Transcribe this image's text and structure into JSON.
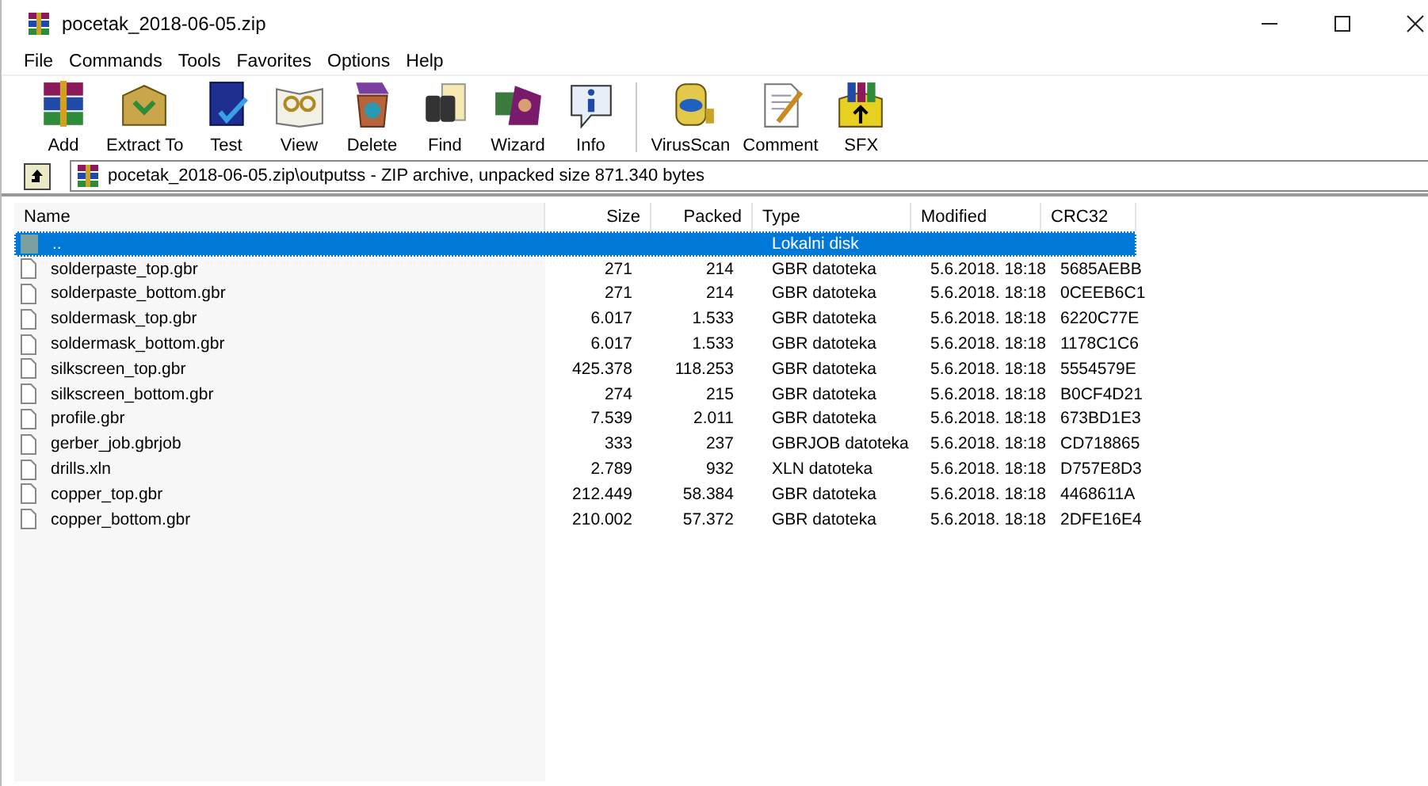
{
  "window": {
    "title": "pocetak_2018-06-05.zip"
  },
  "menu": [
    "File",
    "Commands",
    "Tools",
    "Favorites",
    "Options",
    "Help"
  ],
  "toolbar": [
    {
      "label": "Add",
      "kind": "add"
    },
    {
      "label": "Extract To",
      "kind": "extract"
    },
    {
      "label": "Test",
      "kind": "test"
    },
    {
      "label": "View",
      "kind": "view"
    },
    {
      "label": "Delete",
      "kind": "delete"
    },
    {
      "label": "Find",
      "kind": "find"
    },
    {
      "label": "Wizard",
      "kind": "wizard"
    },
    {
      "label": "Info",
      "kind": "info"
    },
    {
      "label": "VirusScan",
      "kind": "virus",
      "separator_before": true
    },
    {
      "label": "Comment",
      "kind": "comment"
    },
    {
      "label": "SFX",
      "kind": "sfx"
    }
  ],
  "address": {
    "path": "pocetak_2018-06-05.zip\\outputss - ZIP archive, unpacked size 871.340 bytes"
  },
  "table": {
    "columns": [
      "Name",
      "Size",
      "Packed",
      "Type",
      "Modified",
      "CRC32"
    ],
    "rows": [
      {
        "kind": "up",
        "name": "..",
        "size": "",
        "packed": "",
        "type": "Lokalni disk",
        "modified": "",
        "crc": "",
        "selected": true
      },
      {
        "kind": "file",
        "name": "solderpaste_top.gbr",
        "size": "271",
        "packed": "214",
        "type": "GBR datoteka",
        "modified": "5.6.2018. 18:18",
        "crc": "5685AEBB",
        "selected": false
      },
      {
        "kind": "file",
        "name": "solderpaste_bottom.gbr",
        "size": "271",
        "packed": "214",
        "type": "GBR datoteka",
        "modified": "5.6.2018. 18:18",
        "crc": "0CEEB6C1",
        "selected": false
      },
      {
        "kind": "file",
        "name": "soldermask_top.gbr",
        "size": "6.017",
        "packed": "1.533",
        "type": "GBR datoteka",
        "modified": "5.6.2018. 18:18",
        "crc": "6220C77E",
        "selected": false
      },
      {
        "kind": "file",
        "name": "soldermask_bottom.gbr",
        "size": "6.017",
        "packed": "1.533",
        "type": "GBR datoteka",
        "modified": "5.6.2018. 18:18",
        "crc": "1178C1C6",
        "selected": false
      },
      {
        "kind": "file",
        "name": "silkscreen_top.gbr",
        "size": "425.378",
        "packed": "118.253",
        "type": "GBR datoteka",
        "modified": "5.6.2018. 18:18",
        "crc": "5554579E",
        "selected": false
      },
      {
        "kind": "file",
        "name": "silkscreen_bottom.gbr",
        "size": "274",
        "packed": "215",
        "type": "GBR datoteka",
        "modified": "5.6.2018. 18:18",
        "crc": "B0CF4D21",
        "selected": false
      },
      {
        "kind": "file",
        "name": "profile.gbr",
        "size": "7.539",
        "packed": "2.011",
        "type": "GBR datoteka",
        "modified": "5.6.2018. 18:18",
        "crc": "673BD1E3",
        "selected": false
      },
      {
        "kind": "file",
        "name": "gerber_job.gbrjob",
        "size": "333",
        "packed": "237",
        "type": "GBRJOB datoteka",
        "modified": "5.6.2018. 18:18",
        "crc": "CD718865",
        "selected": false
      },
      {
        "kind": "file",
        "name": "drills.xln",
        "size": "2.789",
        "packed": "932",
        "type": "XLN datoteka",
        "modified": "5.6.2018. 18:18",
        "crc": "D757E8D3",
        "selected": false
      },
      {
        "kind": "file",
        "name": "copper_top.gbr",
        "size": "212.449",
        "packed": "58.384",
        "type": "GBR datoteka",
        "modified": "5.6.2018. 18:18",
        "crc": "4468611A",
        "selected": false
      },
      {
        "kind": "file",
        "name": "copper_bottom.gbr",
        "size": "210.002",
        "packed": "57.372",
        "type": "GBR datoteka",
        "modified": "5.6.2018. 18:18",
        "crc": "2DFE16E4",
        "selected": false
      }
    ]
  }
}
